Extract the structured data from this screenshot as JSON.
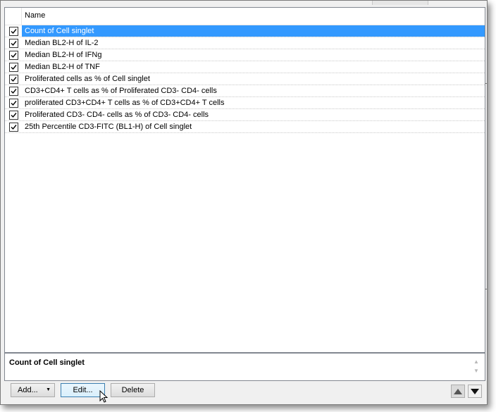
{
  "list": {
    "column_header": "Name",
    "items": [
      {
        "label": "Count of Cell singlet",
        "checked": true,
        "selected": true
      },
      {
        "label": "Median BL2-H of IL-2",
        "checked": true,
        "selected": false
      },
      {
        "label": "Median BL2-H of IFNg",
        "checked": true,
        "selected": false
      },
      {
        "label": "Median BL2-H of TNF",
        "checked": true,
        "selected": false
      },
      {
        "label": "Proliferated cells as % of Cell singlet",
        "checked": true,
        "selected": false
      },
      {
        "label": "CD3+CD4+ T cells as % of Proliferated CD3- CD4- cells",
        "checked": true,
        "selected": false
      },
      {
        "label": "proliferated CD3+CD4+ T cells as % of CD3+CD4+ T cells",
        "checked": true,
        "selected": false
      },
      {
        "label": "Proliferated CD3- CD4- cells as % of CD3- CD4- cells",
        "checked": true,
        "selected": false
      },
      {
        "label": "25th Percentile CD3-FITC (BL1-H) of Cell singlet",
        "checked": true,
        "selected": false
      }
    ]
  },
  "description": {
    "text": "Count of Cell singlet"
  },
  "buttons": {
    "add_label": "Add...",
    "edit_label": "Edit...",
    "delete_label": "Delete"
  },
  "colors": {
    "selection": "#3399ff",
    "window_bg": "#f0f0f0"
  },
  "icons": {
    "add_dropdown": "chevron-down-icon",
    "move_up": "triangle-up-icon",
    "move_down": "triangle-down-icon",
    "cursor": "mouse-pointer-icon"
  }
}
